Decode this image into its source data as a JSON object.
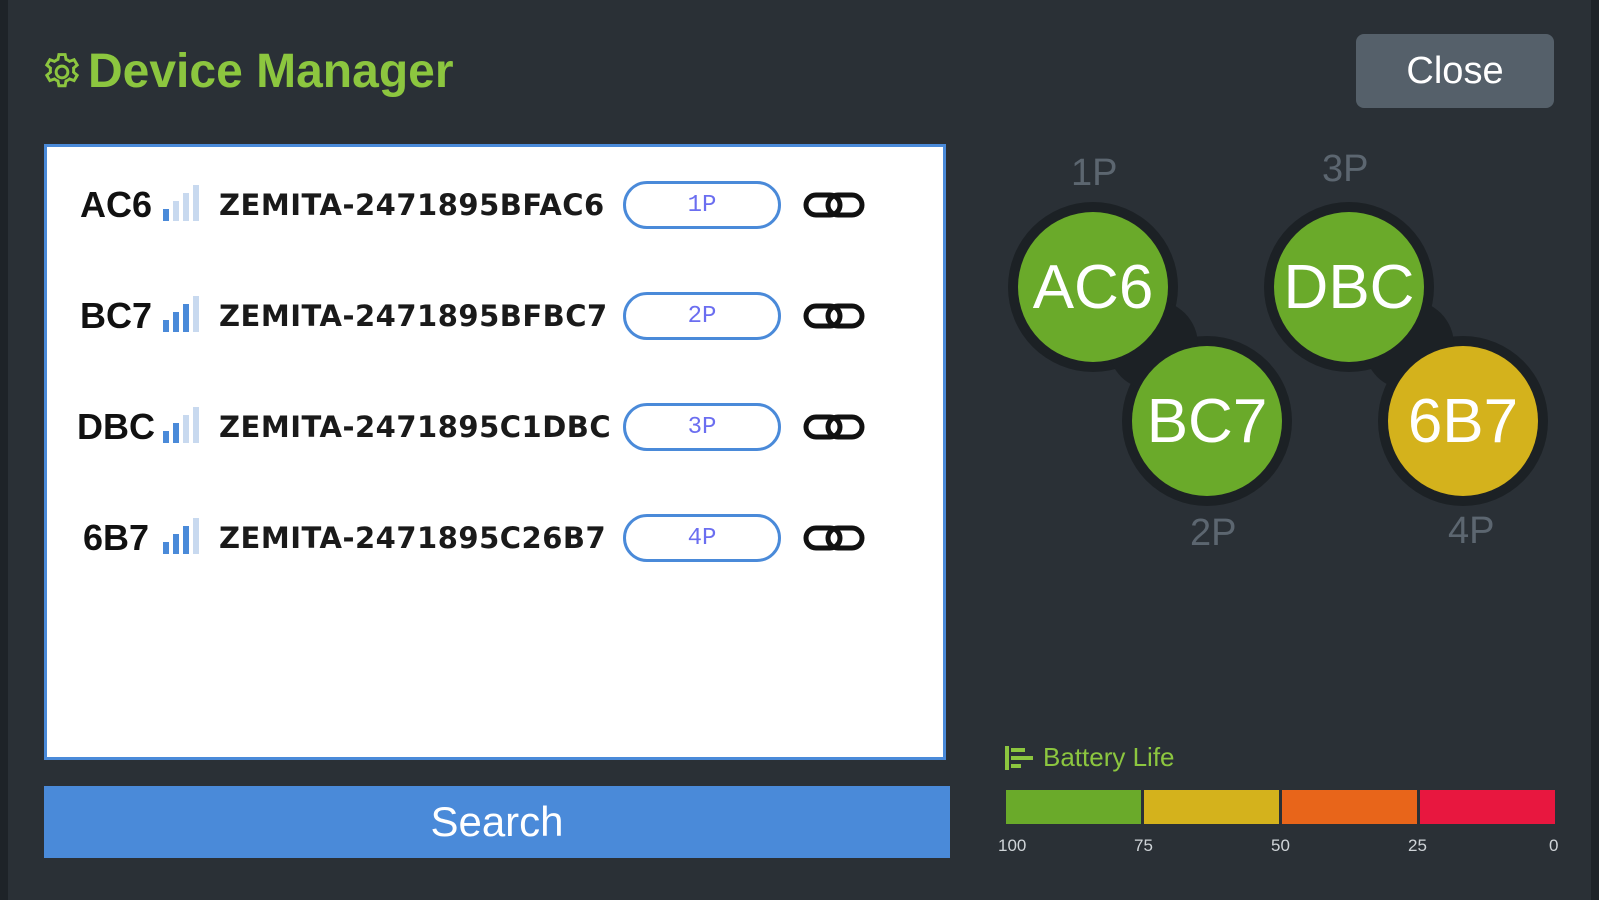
{
  "window": {
    "title": "Device Manager",
    "title_icon": "gear-icon",
    "close_label": "Close"
  },
  "devices": [
    {
      "code": "AC6",
      "name": "ZEMITA-2471895BFAC6",
      "slot": "1P",
      "signal_bars": 1
    },
    {
      "code": "BC7",
      "name": "ZEMITA-2471895BFBC7",
      "slot": "2P",
      "signal_bars": 3
    },
    {
      "code": "DBC",
      "name": "ZEMITA-2471895C1DBC",
      "slot": "3P",
      "signal_bars": 2
    },
    {
      "code": "6B7",
      "name": "ZEMITA-2471895C26B7",
      "slot": "4P",
      "signal_bars": 3
    }
  ],
  "search_label": "Search",
  "player_map": {
    "labels": {
      "p1": "1P",
      "p2": "2P",
      "p3": "3P",
      "p4": "4P"
    },
    "bubbles": [
      {
        "code": "AC6",
        "slot": "1P",
        "color": "#6aaa2a"
      },
      {
        "code": "BC7",
        "slot": "2P",
        "color": "#6aaa2a"
      },
      {
        "code": "DBC",
        "slot": "3P",
        "color": "#6aaa2a"
      },
      {
        "code": "6B7",
        "slot": "4P",
        "color": "#d4b21c"
      }
    ]
  },
  "battery": {
    "title": "Battery Life",
    "icon": "battery-list-icon",
    "segments": [
      {
        "color": "#6aaa2a"
      },
      {
        "color": "#d4b21c"
      },
      {
        "color": "#e8651a"
      },
      {
        "color": "#e8173f"
      }
    ],
    "ticks": [
      "100",
      "75",
      "50",
      "25",
      "0"
    ]
  },
  "colors": {
    "accent": "#8cc63f",
    "primary_blue": "#4a8ad9",
    "background": "#2a3036"
  }
}
